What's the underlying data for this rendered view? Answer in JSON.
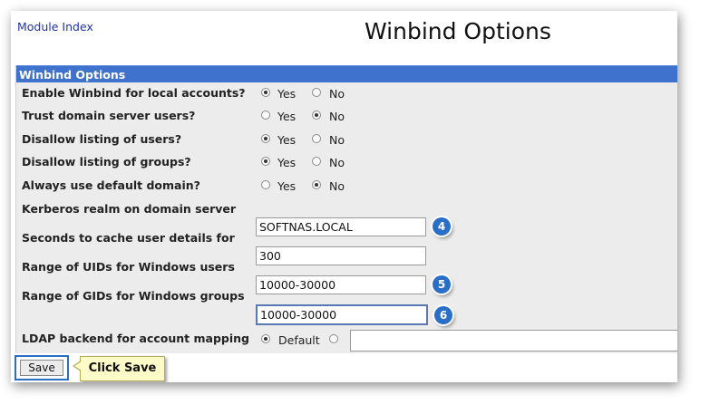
{
  "nav": {
    "module_index": "Module Index"
  },
  "page": {
    "title": "Winbind Options"
  },
  "panel": {
    "header": "Winbind Options"
  },
  "fields": [
    {
      "label": "Enable Winbind for local accounts?",
      "yes": "Yes",
      "no": "No",
      "selected": "yes"
    },
    {
      "label": "Trust domain server users?",
      "yes": "Yes",
      "no": "No",
      "selected": "no"
    },
    {
      "label": "Disallow listing of users?",
      "yes": "Yes",
      "no": "No",
      "selected": "yes"
    },
    {
      "label": "Disallow listing of groups?",
      "yes": "Yes",
      "no": "No",
      "selected": "yes"
    },
    {
      "label": "Always use default domain?",
      "yes": "Yes",
      "no": "No",
      "selected": "no"
    }
  ],
  "kerberos": {
    "label": "Kerberos realm on domain server",
    "value": "SOFTNAS.LOCAL",
    "step": "4"
  },
  "cache": {
    "label": "Seconds to cache user details for",
    "value": "300"
  },
  "uids": {
    "label": "Range of UIDs for Windows users",
    "value": "10000-30000",
    "step": "5"
  },
  "gids": {
    "label": "Range of GIDs for Windows groups",
    "value": "10000-30000",
    "step": "6"
  },
  "ldap": {
    "label": "LDAP backend for account mapping",
    "default_label": "Default",
    "selected": "default",
    "custom_value": ""
  },
  "actions": {
    "save_label": "Save",
    "callout": "Click Save"
  },
  "colors": {
    "header_bg": "#3f72cc",
    "badge": "#2a6fc7",
    "callout_bg": "#fdfbc8",
    "save_highlight": "#2b6fc2"
  }
}
